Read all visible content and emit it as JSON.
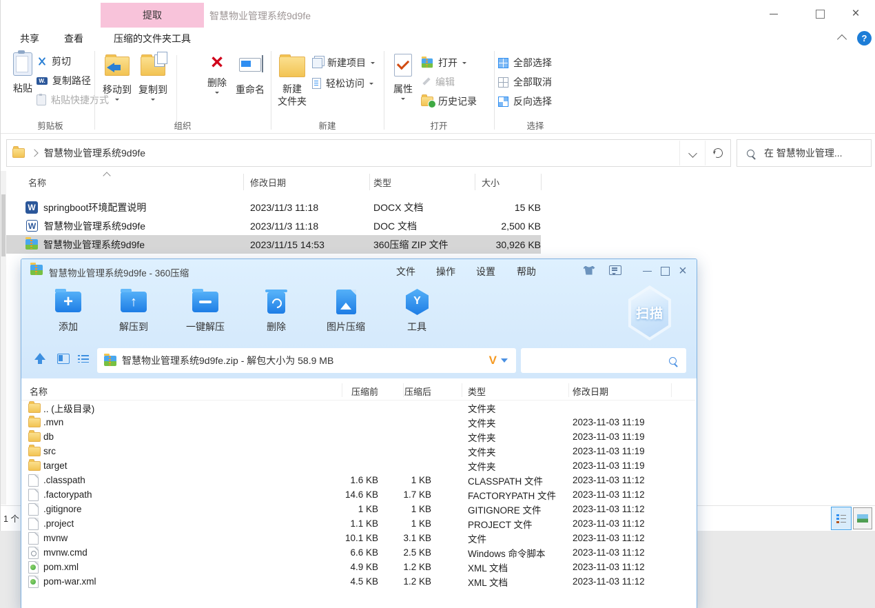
{
  "colors": {
    "accent_blue": "#2f8ef1",
    "ribbon_pink_tab": "#f8c3da",
    "folder_yellow": "#f2c353",
    "selected_row_gray": "#d6d6d6",
    "zip_chrome_blue": "#d6eafc",
    "help_blue": "#1d7dd7",
    "v_logo_orange": "#f59a23",
    "delete_red": "#d0021b"
  },
  "explorer": {
    "window_title": "智慧物业管理系统9d9fe",
    "contextual_tab_header": "提取",
    "tabs": [
      {
        "label": "共享"
      },
      {
        "label": "查看"
      },
      {
        "label": "压缩的文件夹工具"
      }
    ],
    "ribbon": {
      "paste": "粘贴",
      "cut": "剪切",
      "copy_path": "复制路径",
      "paste_shortcut": "粘贴快捷方式",
      "clipboard_group": "剪贴板",
      "move_to": "移动到",
      "copy_to": "复制到",
      "delete": "删除",
      "rename": "重命名",
      "organize_group": "组织",
      "new_folder_line1": "新建",
      "new_folder_line2": "文件夹",
      "new_item": "新建项目",
      "easy_access": "轻松访问",
      "new_group": "新建",
      "properties": "属性",
      "open": "打开",
      "edit": "编辑",
      "history": "历史记录",
      "open_group": "打开",
      "select_all": "全部选择",
      "select_none": "全部取消",
      "invert_selection": "反向选择",
      "select_group": "选择"
    },
    "address_path": "智慧物业管理系统9d9fe",
    "search_placeholder": "在 智慧物业管理...",
    "columns": {
      "name": "名称",
      "date": "修改日期",
      "type": "类型",
      "size": "大小"
    },
    "files": [
      {
        "name": "springboot环境配置说明",
        "date": "2023/11/3 11:18",
        "type": "DOCX 文档",
        "size": "15 KB",
        "icon": "word-solid"
      },
      {
        "name": "智慧物业管理系统9d9fe",
        "date": "2023/11/3 11:18",
        "type": "DOC 文档",
        "size": "2,500 KB",
        "icon": "word-outline"
      },
      {
        "name": "智慧物业管理系统9d9fe",
        "date": "2023/11/15 14:53",
        "type": "360压缩 ZIP 文件",
        "size": "30,926 KB",
        "icon": "zip-archive",
        "selected": true
      }
    ],
    "status_fragment": "1 个"
  },
  "zip": {
    "window_title": "智慧物业管理系统9d9fe - 360压缩",
    "menus": [
      {
        "label": "文件"
      },
      {
        "label": "操作"
      },
      {
        "label": "设置"
      },
      {
        "label": "帮助"
      }
    ],
    "toolbar": [
      {
        "label": "添加",
        "icon": "folder-plus"
      },
      {
        "label": "解压到",
        "icon": "folder-up-arrow"
      },
      {
        "label": "一键解压",
        "icon": "folder-open"
      },
      {
        "label": "删除",
        "icon": "trash-recycle"
      },
      {
        "label": "图片压缩",
        "icon": "picture-document"
      },
      {
        "label": "工具",
        "icon": "hexagon-tools"
      }
    ],
    "scan_badge": "扫描",
    "logo_letter": "V",
    "path_text": "智慧物业管理系统9d9fe.zip - 解包大小为 58.9 MB",
    "columns": {
      "name": "名称",
      "before": "压缩前",
      "after": "压缩后",
      "type": "类型",
      "date": "修改日期"
    },
    "rows": [
      {
        "name": ".. (上级目录)",
        "before": "",
        "after": "",
        "type": "文件夹",
        "date": "",
        "icon": "folder"
      },
      {
        "name": ".mvn",
        "before": "",
        "after": "",
        "type": "文件夹",
        "date": "2023-11-03 11:19",
        "icon": "folder"
      },
      {
        "name": "db",
        "before": "",
        "after": "",
        "type": "文件夹",
        "date": "2023-11-03 11:19",
        "icon": "folder"
      },
      {
        "name": "src",
        "before": "",
        "after": "",
        "type": "文件夹",
        "date": "2023-11-03 11:19",
        "icon": "folder"
      },
      {
        "name": "target",
        "before": "",
        "after": "",
        "type": "文件夹",
        "date": "2023-11-03 11:19",
        "icon": "folder"
      },
      {
        "name": ".classpath",
        "before": "1.6 KB",
        "after": "1 KB",
        "type": "CLASSPATH 文件",
        "date": "2023-11-03 11:12",
        "icon": "file"
      },
      {
        "name": ".factorypath",
        "before": "14.6 KB",
        "after": "1.7 KB",
        "type": "FACTORYPATH 文件",
        "date": "2023-11-03 11:12",
        "icon": "file"
      },
      {
        "name": ".gitignore",
        "before": "1 KB",
        "after": "1 KB",
        "type": "GITIGNORE 文件",
        "date": "2023-11-03 11:12",
        "icon": "file"
      },
      {
        "name": ".project",
        "before": "1.1 KB",
        "after": "1 KB",
        "type": "PROJECT 文件",
        "date": "2023-11-03 11:12",
        "icon": "file"
      },
      {
        "name": "mvnw",
        "before": "10.1 KB",
        "after": "3.1 KB",
        "type": "文件",
        "date": "2023-11-03 11:12",
        "icon": "file"
      },
      {
        "name": "mvnw.cmd",
        "before": "6.6 KB",
        "after": "2.5 KB",
        "type": "Windows 命令脚本",
        "date": "2023-11-03 11:12",
        "icon": "cmd-file"
      },
      {
        "name": "pom.xml",
        "before": "4.9 KB",
        "after": "1.2 KB",
        "type": "XML 文档",
        "date": "2023-11-03 11:12",
        "icon": "xml-file"
      },
      {
        "name": "pom-war.xml",
        "before": "4.5 KB",
        "after": "1.2 KB",
        "type": "XML 文档",
        "date": "2023-11-03 11:12",
        "icon": "xml-file"
      }
    ]
  }
}
